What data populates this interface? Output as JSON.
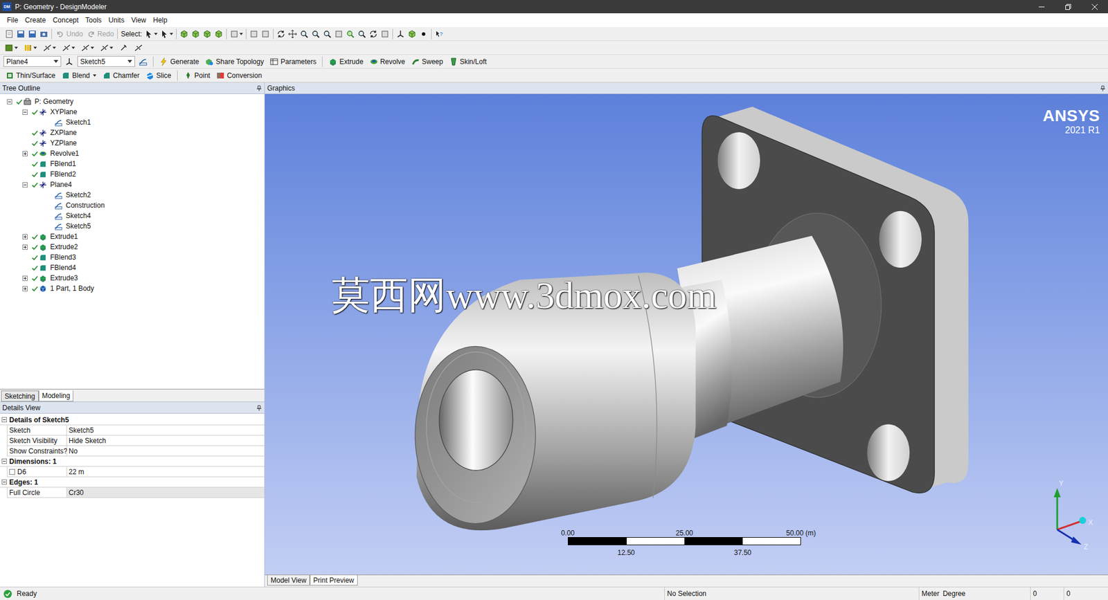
{
  "window": {
    "title": "P: Geometry - DesignModeler",
    "app_icon": "DM"
  },
  "menu": [
    "File",
    "Create",
    "Concept",
    "Tools",
    "Units",
    "View",
    "Help"
  ],
  "toolbar1": {
    "undo": {
      "label": "Undo",
      "disabled": true
    },
    "redo": {
      "label": "Redo",
      "disabled": true
    },
    "select": "Select:"
  },
  "toolbar3": {
    "plane": "Plane4",
    "sketch": "Sketch5",
    "buttons": [
      "Generate",
      "Share Topology",
      "Parameters",
      "Extrude",
      "Revolve",
      "Sweep",
      "Skin/Loft"
    ]
  },
  "toolbar4": [
    {
      "label": "Thin/Surface",
      "dropdown": false
    },
    {
      "label": "Blend",
      "dropdown": true
    },
    {
      "label": "Chamfer",
      "dropdown": false
    },
    {
      "label": "Slice",
      "dropdown": false
    },
    {
      "label": "Point",
      "dropdown": false
    },
    {
      "label": "Conversion",
      "dropdown": false
    }
  ],
  "tree": {
    "title": "Tree Outline",
    "items": [
      {
        "label": "P: Geometry",
        "depth": 0,
        "kind": "geometry",
        "expandable": true,
        "expanded": true,
        "checked": true
      },
      {
        "label": "XYPlane",
        "depth": 1,
        "kind": "plane",
        "expandable": true,
        "expanded": true,
        "checked": true
      },
      {
        "label": "Sketch1",
        "depth": 2,
        "kind": "sketch",
        "expandable": false,
        "expanded": false,
        "checked": false
      },
      {
        "label": "ZXPlane",
        "depth": 1,
        "kind": "plane",
        "expandable": false,
        "expanded": false,
        "checked": true
      },
      {
        "label": "YZPlane",
        "depth": 1,
        "kind": "plane",
        "expandable": false,
        "expanded": false,
        "checked": true
      },
      {
        "label": "Revolve1",
        "depth": 1,
        "kind": "revolve",
        "expandable": true,
        "expanded": false,
        "checked": true
      },
      {
        "label": "FBlend1",
        "depth": 1,
        "kind": "blend",
        "expandable": false,
        "expanded": false,
        "checked": true
      },
      {
        "label": "FBlend2",
        "depth": 1,
        "kind": "blend",
        "expandable": false,
        "expanded": false,
        "checked": true
      },
      {
        "label": "Plane4",
        "depth": 1,
        "kind": "plane",
        "expandable": true,
        "expanded": true,
        "checked": true
      },
      {
        "label": "Sketch2",
        "depth": 2,
        "kind": "sketch",
        "expandable": false,
        "expanded": false,
        "checked": false
      },
      {
        "label": "Construction",
        "depth": 2,
        "kind": "sketch",
        "expandable": false,
        "expanded": false,
        "checked": false
      },
      {
        "label": "Sketch4",
        "depth": 2,
        "kind": "sketch",
        "expandable": false,
        "expanded": false,
        "checked": false
      },
      {
        "label": "Sketch5",
        "depth": 2,
        "kind": "sketch",
        "expandable": false,
        "expanded": false,
        "checked": false
      },
      {
        "label": "Extrude1",
        "depth": 1,
        "kind": "extrude",
        "expandable": true,
        "expanded": false,
        "checked": true
      },
      {
        "label": "Extrude2",
        "depth": 1,
        "kind": "extrude",
        "expandable": true,
        "expanded": false,
        "checked": true
      },
      {
        "label": "FBlend3",
        "depth": 1,
        "kind": "blend",
        "expandable": false,
        "expanded": false,
        "checked": true
      },
      {
        "label": "FBlend4",
        "depth": 1,
        "kind": "blend",
        "expandable": false,
        "expanded": false,
        "checked": true
      },
      {
        "label": "Extrude3",
        "depth": 1,
        "kind": "extrude",
        "expandable": true,
        "expanded": false,
        "checked": true
      },
      {
        "label": "1 Part, 1 Body",
        "depth": 1,
        "kind": "body",
        "expandable": true,
        "expanded": false,
        "checked": true
      }
    ]
  },
  "tabs": [
    {
      "label": "Sketching",
      "selected": false
    },
    {
      "label": "Modeling",
      "selected": true
    }
  ],
  "details": {
    "title": "Details View",
    "sections": [
      {
        "title": "Details of Sketch5",
        "rows": [
          {
            "label": "Sketch",
            "value": "Sketch5",
            "kind": "text",
            "highlighted": false
          },
          {
            "label": "Sketch Visibility",
            "value": "Hide Sketch",
            "kind": "text",
            "highlighted": false
          },
          {
            "label": "Show Constraints?",
            "value": "No",
            "kind": "text",
            "highlighted": false
          }
        ]
      },
      {
        "title": "Dimensions: 1",
        "rows": [
          {
            "label": "D6",
            "value": "22 m",
            "kind": "checkbox",
            "checked": false,
            "highlighted": false
          }
        ]
      },
      {
        "title": "Edges: 1",
        "rows": [
          {
            "label": "Full Circle",
            "value": "Cr30",
            "kind": "text",
            "highlighted": true
          }
        ]
      }
    ]
  },
  "graphics": {
    "title": "Graphics",
    "logo": {
      "name": "ANSYS",
      "version": "2021 R1"
    },
    "watermark": "莫西网www.3dmox.com",
    "scale": {
      "top": [
        "0.00",
        "25.00",
        "50.00 (m)"
      ],
      "bottom": [
        "12.50",
        "37.50"
      ]
    },
    "axes": [
      "Y",
      "X",
      "Z"
    ]
  },
  "view_tabs": [
    {
      "label": "Model View",
      "selected": true
    },
    {
      "label": "Print Preview",
      "selected": false
    }
  ],
  "status_bar": {
    "status": "Ready",
    "selection": "No Selection",
    "units": [
      "Meter",
      "Degree"
    ],
    "fields": [
      "0",
      "0"
    ]
  }
}
